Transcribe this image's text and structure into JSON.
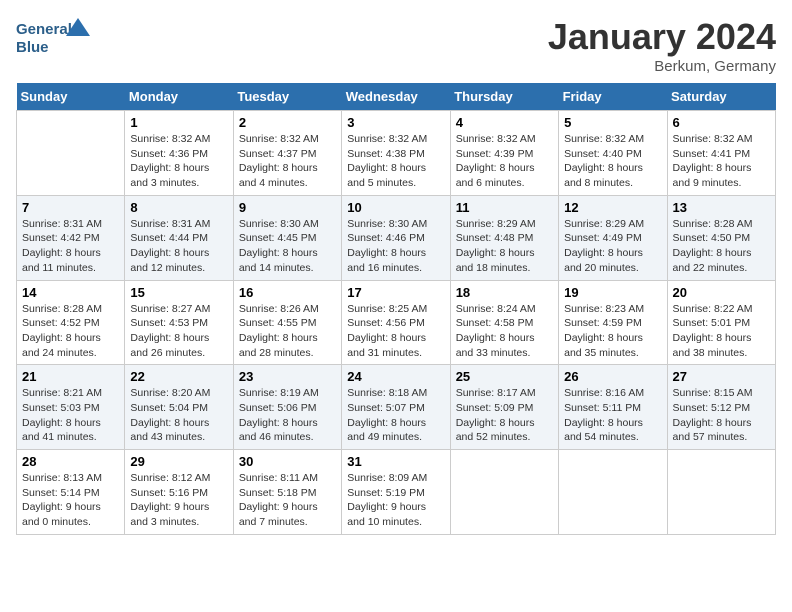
{
  "header": {
    "logo_line1": "General",
    "logo_line2": "Blue",
    "month_title": "January 2024",
    "location": "Berkum, Germany"
  },
  "days_of_week": [
    "Sunday",
    "Monday",
    "Tuesday",
    "Wednesday",
    "Thursday",
    "Friday",
    "Saturday"
  ],
  "weeks": [
    [
      {
        "day": "",
        "info": ""
      },
      {
        "day": "1",
        "info": "Sunrise: 8:32 AM\nSunset: 4:36 PM\nDaylight: 8 hours\nand 3 minutes."
      },
      {
        "day": "2",
        "info": "Sunrise: 8:32 AM\nSunset: 4:37 PM\nDaylight: 8 hours\nand 4 minutes."
      },
      {
        "day": "3",
        "info": "Sunrise: 8:32 AM\nSunset: 4:38 PM\nDaylight: 8 hours\nand 5 minutes."
      },
      {
        "day": "4",
        "info": "Sunrise: 8:32 AM\nSunset: 4:39 PM\nDaylight: 8 hours\nand 6 minutes."
      },
      {
        "day": "5",
        "info": "Sunrise: 8:32 AM\nSunset: 4:40 PM\nDaylight: 8 hours\nand 8 minutes."
      },
      {
        "day": "6",
        "info": "Sunrise: 8:32 AM\nSunset: 4:41 PM\nDaylight: 8 hours\nand 9 minutes."
      }
    ],
    [
      {
        "day": "7",
        "info": "Sunrise: 8:31 AM\nSunset: 4:42 PM\nDaylight: 8 hours\nand 11 minutes."
      },
      {
        "day": "8",
        "info": "Sunrise: 8:31 AM\nSunset: 4:44 PM\nDaylight: 8 hours\nand 12 minutes."
      },
      {
        "day": "9",
        "info": "Sunrise: 8:30 AM\nSunset: 4:45 PM\nDaylight: 8 hours\nand 14 minutes."
      },
      {
        "day": "10",
        "info": "Sunrise: 8:30 AM\nSunset: 4:46 PM\nDaylight: 8 hours\nand 16 minutes."
      },
      {
        "day": "11",
        "info": "Sunrise: 8:29 AM\nSunset: 4:48 PM\nDaylight: 8 hours\nand 18 minutes."
      },
      {
        "day": "12",
        "info": "Sunrise: 8:29 AM\nSunset: 4:49 PM\nDaylight: 8 hours\nand 20 minutes."
      },
      {
        "day": "13",
        "info": "Sunrise: 8:28 AM\nSunset: 4:50 PM\nDaylight: 8 hours\nand 22 minutes."
      }
    ],
    [
      {
        "day": "14",
        "info": "Sunrise: 8:28 AM\nSunset: 4:52 PM\nDaylight: 8 hours\nand 24 minutes."
      },
      {
        "day": "15",
        "info": "Sunrise: 8:27 AM\nSunset: 4:53 PM\nDaylight: 8 hours\nand 26 minutes."
      },
      {
        "day": "16",
        "info": "Sunrise: 8:26 AM\nSunset: 4:55 PM\nDaylight: 8 hours\nand 28 minutes."
      },
      {
        "day": "17",
        "info": "Sunrise: 8:25 AM\nSunset: 4:56 PM\nDaylight: 8 hours\nand 31 minutes."
      },
      {
        "day": "18",
        "info": "Sunrise: 8:24 AM\nSunset: 4:58 PM\nDaylight: 8 hours\nand 33 minutes."
      },
      {
        "day": "19",
        "info": "Sunrise: 8:23 AM\nSunset: 4:59 PM\nDaylight: 8 hours\nand 35 minutes."
      },
      {
        "day": "20",
        "info": "Sunrise: 8:22 AM\nSunset: 5:01 PM\nDaylight: 8 hours\nand 38 minutes."
      }
    ],
    [
      {
        "day": "21",
        "info": "Sunrise: 8:21 AM\nSunset: 5:03 PM\nDaylight: 8 hours\nand 41 minutes."
      },
      {
        "day": "22",
        "info": "Sunrise: 8:20 AM\nSunset: 5:04 PM\nDaylight: 8 hours\nand 43 minutes."
      },
      {
        "day": "23",
        "info": "Sunrise: 8:19 AM\nSunset: 5:06 PM\nDaylight: 8 hours\nand 46 minutes."
      },
      {
        "day": "24",
        "info": "Sunrise: 8:18 AM\nSunset: 5:07 PM\nDaylight: 8 hours\nand 49 minutes."
      },
      {
        "day": "25",
        "info": "Sunrise: 8:17 AM\nSunset: 5:09 PM\nDaylight: 8 hours\nand 52 minutes."
      },
      {
        "day": "26",
        "info": "Sunrise: 8:16 AM\nSunset: 5:11 PM\nDaylight: 8 hours\nand 54 minutes."
      },
      {
        "day": "27",
        "info": "Sunrise: 8:15 AM\nSunset: 5:12 PM\nDaylight: 8 hours\nand 57 minutes."
      }
    ],
    [
      {
        "day": "28",
        "info": "Sunrise: 8:13 AM\nSunset: 5:14 PM\nDaylight: 9 hours\nand 0 minutes."
      },
      {
        "day": "29",
        "info": "Sunrise: 8:12 AM\nSunset: 5:16 PM\nDaylight: 9 hours\nand 3 minutes."
      },
      {
        "day": "30",
        "info": "Sunrise: 8:11 AM\nSunset: 5:18 PM\nDaylight: 9 hours\nand 7 minutes."
      },
      {
        "day": "31",
        "info": "Sunrise: 8:09 AM\nSunset: 5:19 PM\nDaylight: 9 hours\nand 10 minutes."
      },
      {
        "day": "",
        "info": ""
      },
      {
        "day": "",
        "info": ""
      },
      {
        "day": "",
        "info": ""
      }
    ]
  ]
}
